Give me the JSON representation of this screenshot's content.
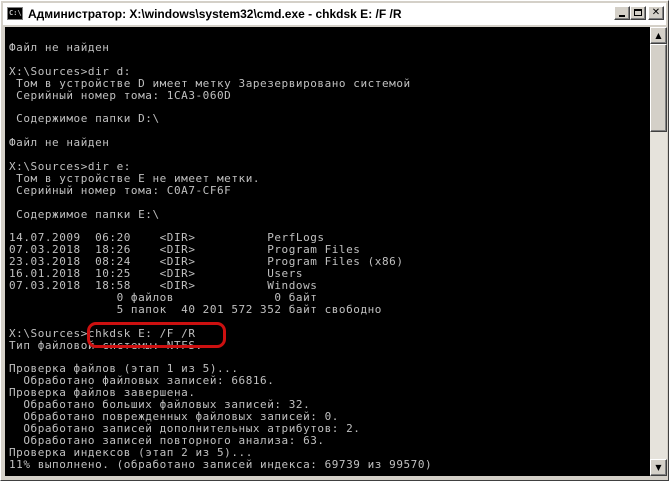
{
  "window": {
    "title": "Администратор: X:\\windows\\system32\\cmd.exe - chkdsk  E: /F /R",
    "icon_label": "C:\\"
  },
  "titlebar_buttons": {
    "minimize": "minimize-icon",
    "maximize": "maximize-icon",
    "close": "✕"
  },
  "scrollbar": {
    "up_arrow": "▲",
    "down_arrow": "▼"
  },
  "highlight_color": "#cc1010",
  "console": {
    "background": "#000000",
    "foreground": "#c0c0c0",
    "lines": [
      "Файл не найден",
      "",
      "X:\\Sources>dir d:",
      " Том в устройстве D имеет метку Зарезервировано системой",
      " Серийный номер тома: 1CA3-060D",
      "",
      " Содержимое папки D:\\",
      "",
      "Файл не найден",
      "",
      "X:\\Sources>dir e:",
      " Том в устройстве E не имеет метки.",
      " Серийный номер тома: C0A7-CF6F",
      "",
      " Содержимое папки E:\\",
      "",
      "14.07.2009  06:20    <DIR>          PerfLogs",
      "07.03.2018  18:26    <DIR>          Program Files",
      "23.03.2018  08:24    <DIR>          Program Files (x86)",
      "16.01.2018  10:25    <DIR>          Users",
      "07.03.2018  18:58    <DIR>          Windows",
      "               0 файлов              0 байт",
      "               5 папок  40 201 572 352 байт свободно",
      "",
      "X:\\Sources>chkdsk E: /F /R",
      "Тип файловой системы: NTFS.",
      "",
      "Проверка файлов (этап 1 из 5)...",
      "  Обработано файловых записей: 66816.",
      "Проверка файлов завершена.",
      "  Обработано больших файловых записей: 32.",
      "  Обработано поврежденных файловых записей: 0.",
      "  Обработано записей дополнительных атрибутов: 2.",
      "  Обработано записей повторного анализа: 63.",
      "Проверка индексов (этап 2 из 5)...",
      "11% выполнено. (обработано записей индекса: 69739 из 99570)"
    ]
  }
}
